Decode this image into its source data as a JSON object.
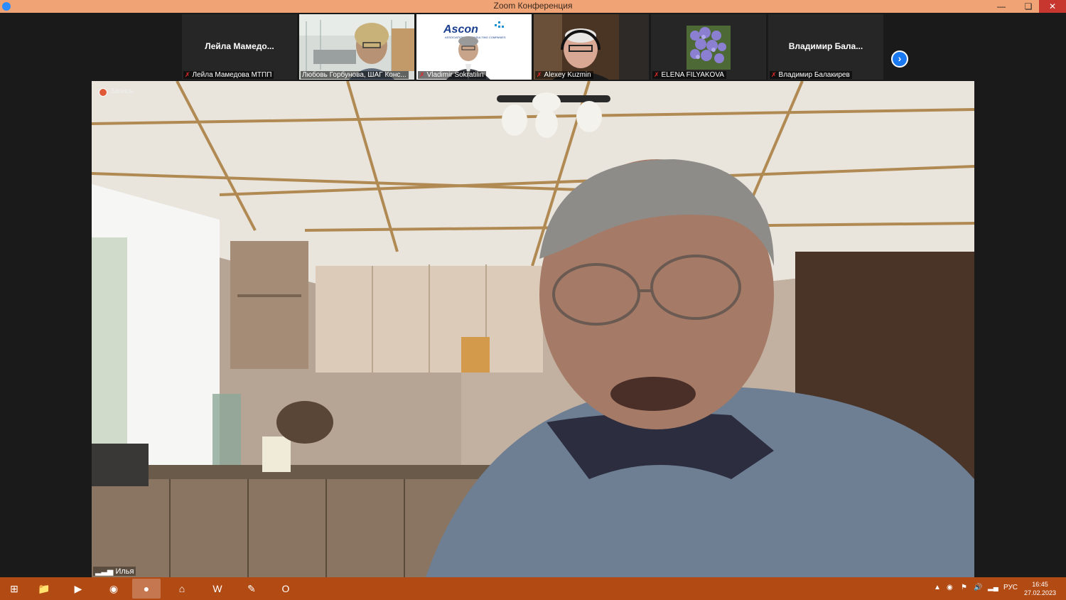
{
  "window": {
    "title": "Zoom Конференция",
    "minimize_icon": "minimize-icon",
    "maximize_icon": "restore-icon",
    "close_icon": "close-icon"
  },
  "gallery": {
    "participants": [
      {
        "display_name": "Лейла  Мамедо...",
        "nameplate": "Лейла Мамедова МТПП",
        "muted": true,
        "video": false
      },
      {
        "display_name": "",
        "nameplate": "Любовь  Горбунова, ШАГ Конс...",
        "muted": false,
        "video": true
      },
      {
        "display_name": "",
        "nameplate": "Vladimir Sokratilin",
        "muted": true,
        "video": true,
        "logo_text": "Ascon",
        "logo_subtitle": "ASSOCIATION OF CONSULTING COMPANIES"
      },
      {
        "display_name": "",
        "nameplate": "Alexey Kuzmin",
        "muted": true,
        "video": true
      },
      {
        "display_name": "",
        "nameplate": "ELENA FILYAKOVA",
        "muted": true,
        "video": true
      },
      {
        "display_name": "Владимир  Бала...",
        "nameplate": "Владимир Балакирев",
        "muted": true,
        "video": false
      }
    ],
    "next_page_icon": "chevron-right-icon"
  },
  "speaker": {
    "recording_label": "Запись",
    "name": "Илья"
  },
  "taskbar": {
    "language": "РУС",
    "time": "16:45",
    "date": "27.02.2023",
    "apps": [
      "windows-start",
      "file-explorer",
      "media-player",
      "chrome",
      "zoom",
      "home",
      "word",
      "paint",
      "outlook"
    ]
  },
  "colors": {
    "titlebar": "#f0a374",
    "taskbar": "#b24a14",
    "muted_mic": "#e02828",
    "next_button": "#1a78f0"
  }
}
